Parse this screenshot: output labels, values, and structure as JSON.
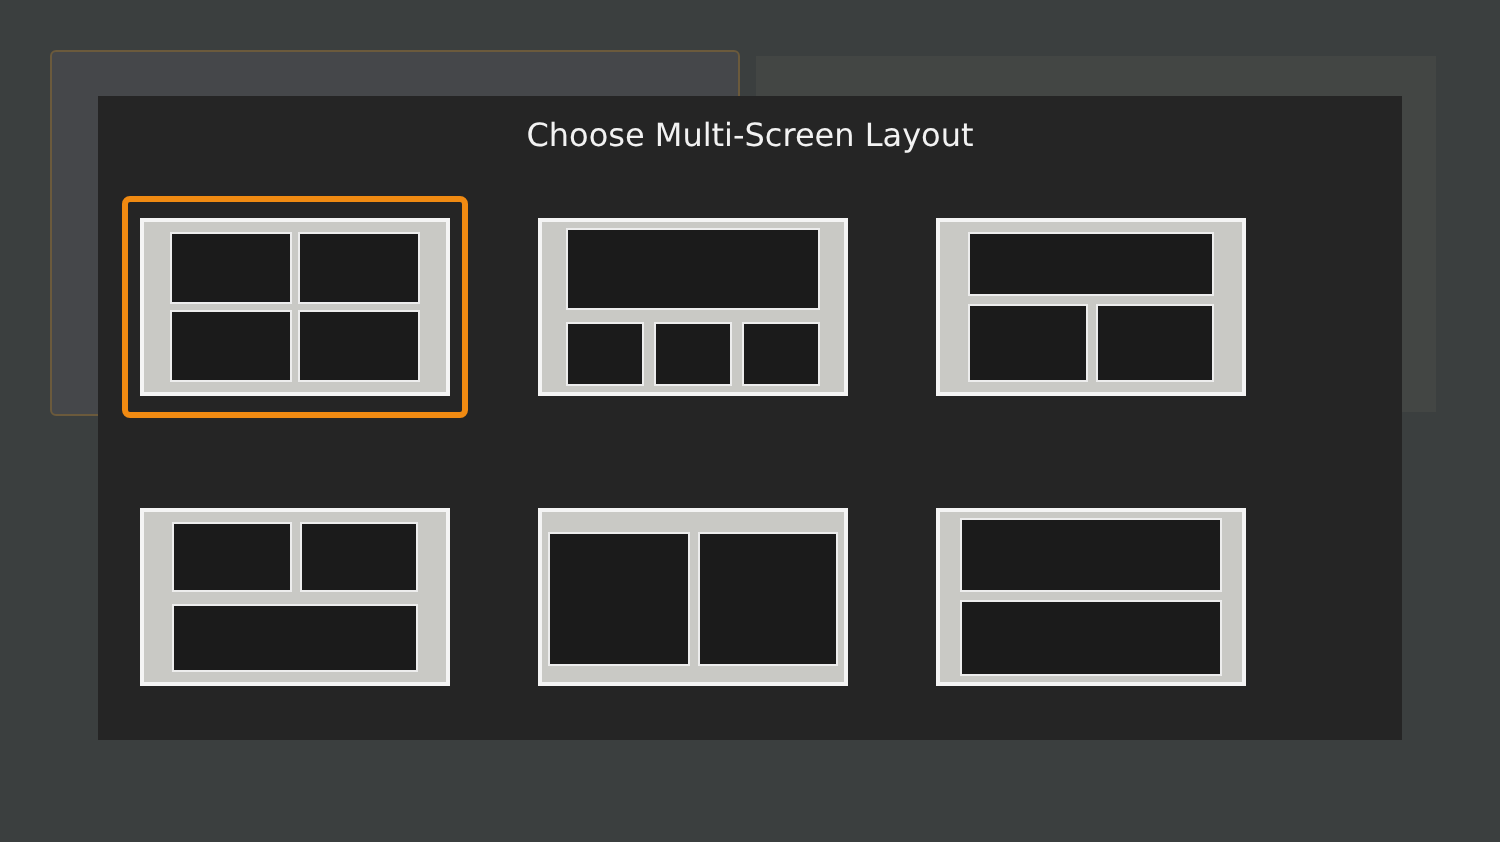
{
  "dialog": {
    "title": "Choose Multi-Screen Layout"
  },
  "layouts": [
    {
      "kind": "quad",
      "selected": true
    },
    {
      "kind": "one-over-three",
      "selected": false
    },
    {
      "kind": "one-over-two",
      "selected": false
    },
    {
      "kind": "two-over-one",
      "selected": false
    },
    {
      "kind": "side-by-side",
      "selected": false
    },
    {
      "kind": "stacked",
      "selected": false
    }
  ]
}
